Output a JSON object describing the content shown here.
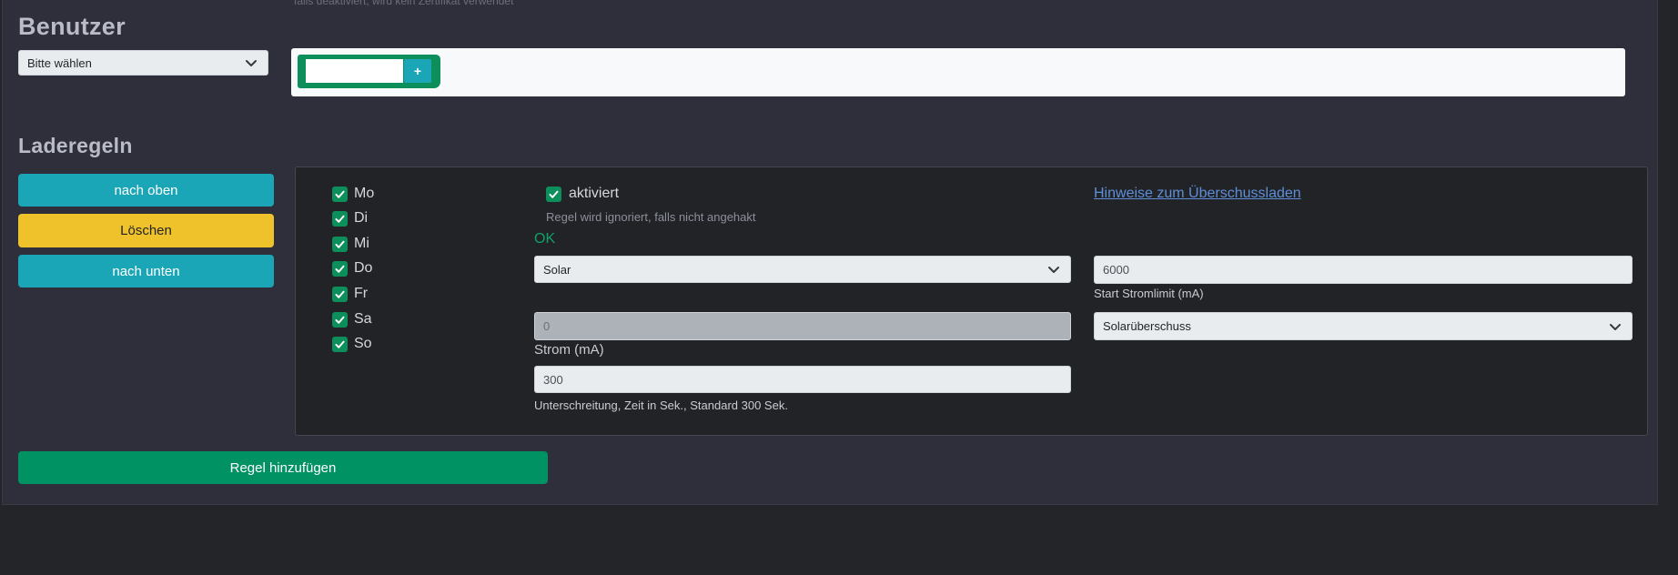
{
  "top_note": "falls deaktiviert, wird kein Zertifikat verwendet",
  "users_section": {
    "title": "Benutzer",
    "select_value": "Bitte wählen",
    "add_button_label": "+",
    "tag_input_value": ""
  },
  "rules_section": {
    "title": "Laderegeln",
    "buttons": {
      "up": "nach oben",
      "delete": "Löschen",
      "down": "nach unten"
    },
    "days": [
      {
        "label": "Mo",
        "checked": true
      },
      {
        "label": "Di",
        "checked": true
      },
      {
        "label": "Mi",
        "checked": true
      },
      {
        "label": "Do",
        "checked": true
      },
      {
        "label": "Fr",
        "checked": true
      },
      {
        "label": "Sa",
        "checked": true
      },
      {
        "label": "So",
        "checked": true
      }
    ],
    "activated_label": "aktiviert",
    "activated_help": "Regel wird ignoriert, falls nicht angehakt",
    "status": "OK",
    "help_link": "Hinweise zum Überschussladen",
    "source_select": "Solar",
    "start_limit_value": "6000",
    "start_limit_label": "Start Stromlimit (mA)",
    "current_value": "0",
    "current_label": "Strom (mA)",
    "mode_select": "Solarüberschuss",
    "undershoot_value": "300",
    "undershoot_label": "Unterschreitung, Zeit in Sek., Standard 300 Sek."
  },
  "add_rule_button": "Regel hinzufügen",
  "colors": {
    "info": "#1ba6b8",
    "warning": "#efc12a",
    "success": "#009263",
    "panel": "#2f2f3c",
    "background": "#242529"
  },
  "icons": {
    "select_arrow": "chevron-down-icon",
    "checkbox": "check-icon"
  }
}
